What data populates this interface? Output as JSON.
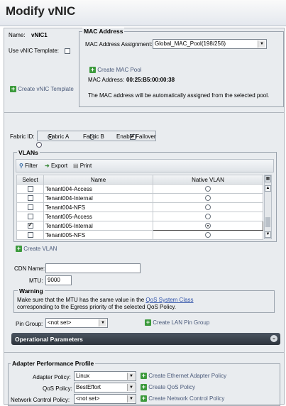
{
  "title": "Modify vNIC",
  "name_label": "Name:",
  "name_value": "vNIC1",
  "use_template_label": "Use vNIC Template:",
  "create_template_link": "Create vNIC Template",
  "mac": {
    "section_title": "MAC Address",
    "assignment_label": "MAC Address Assignment:",
    "assignment_value": "Global_MAC_Pool(198/256)",
    "create_pool_link": "Create MAC Pool",
    "address_label": "MAC Address:",
    "address_value": "00:25:B5:00:00:38",
    "note": "The MAC address will be automatically assigned from the selected pool."
  },
  "fabric": {
    "label": "Fabric ID:",
    "a": "Fabric A",
    "b": "Fabric B",
    "failover": "Enable Failover"
  },
  "vlans": {
    "section_title": "VLANs",
    "filter": "Filter",
    "export": "Export",
    "print": "Print",
    "headers": [
      "Select",
      "Name",
      "Native VLAN"
    ],
    "rows": [
      {
        "name": "Tenant004-Access",
        "checked": false,
        "native": false
      },
      {
        "name": "Tenant004-Internal",
        "checked": false,
        "native": false
      },
      {
        "name": "Tenant004-NFS",
        "checked": false,
        "native": false
      },
      {
        "name": "Tenant005-Access",
        "checked": false,
        "native": false
      },
      {
        "name": "Tenant005-Internal",
        "checked": true,
        "native": true
      },
      {
        "name": "Tenant005-NFS",
        "checked": false,
        "native": false
      }
    ],
    "create_link": "Create VLAN"
  },
  "cdn_label": "CDN Name:",
  "cdn_value": "",
  "mtu_label": "MTU:",
  "mtu_value": "9000",
  "warning": {
    "title": "Warning",
    "line1_pre": "Make sure that the MTU has the same value in the ",
    "line1_link": "QoS System Class",
    "line2": "corresponding to the Egress priority of the selected QoS Policy."
  },
  "pin_group_label": "Pin Group:",
  "pin_group_value": "<not set>",
  "create_pin_link": "Create LAN Pin Group",
  "operational_parameters": "Operational Parameters",
  "adapter": {
    "section_title": "Adapter Performance Profile",
    "adapter_policy_label": "Adapter Policy:",
    "adapter_policy_value": "Linux",
    "create_adapter_link": "Create Ethernet Adapter Policy",
    "qos_label": "QoS Policy:",
    "qos_value": "BestEffort",
    "create_qos_link": "Create QoS Policy",
    "ncp_label": "Network Control Policy:",
    "ncp_value": "<not set>",
    "create_ncp_link": "Create Network Control Policy"
  }
}
